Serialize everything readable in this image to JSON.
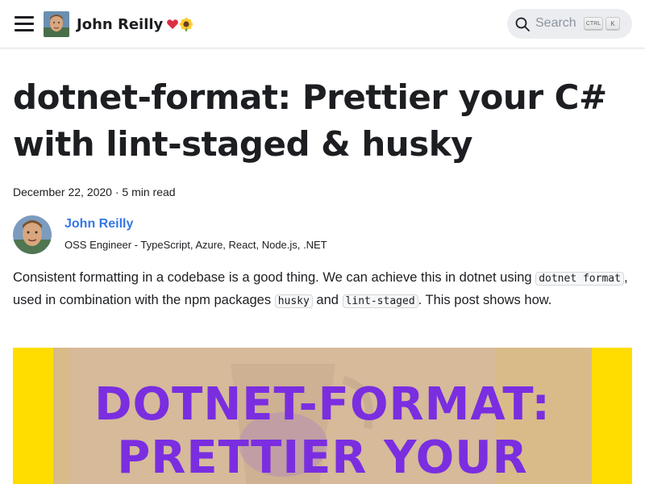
{
  "navbar": {
    "menu_icon": "hamburger-icon",
    "brand_title": "John Reilly",
    "brand_emoji": [
      "heart-icon",
      "sunflower-icon"
    ],
    "search": {
      "placeholder": "Search",
      "kbd_ctrl": "CTRL",
      "kbd_k": "K"
    }
  },
  "article": {
    "title": "dotnet-format: Prettier your C# with lint-staged & husky",
    "meta": "December 22, 2020 · 5 min read",
    "author": {
      "name": "John Reilly",
      "bio": "OSS Engineer - TypeScript, Azure, React, Node.js, .NET"
    },
    "intro": {
      "part1": "Consistent formatting in a codebase is a good thing. We can achieve this in dotnet using ",
      "code1": "dotnet format",
      "part2": ", used in combination with the npm packages ",
      "code2": "husky",
      "part3": " and ",
      "code3": "lint-staged",
      "part4": ". This post shows how."
    },
    "hero": {
      "line1": "DOTNET-FORMAT:",
      "line2": "PRETTIER YOUR"
    }
  },
  "colors": {
    "link": "#3578e5",
    "hero_yellow": "#ffdd00",
    "hero_purple": "#7a2ee0"
  }
}
